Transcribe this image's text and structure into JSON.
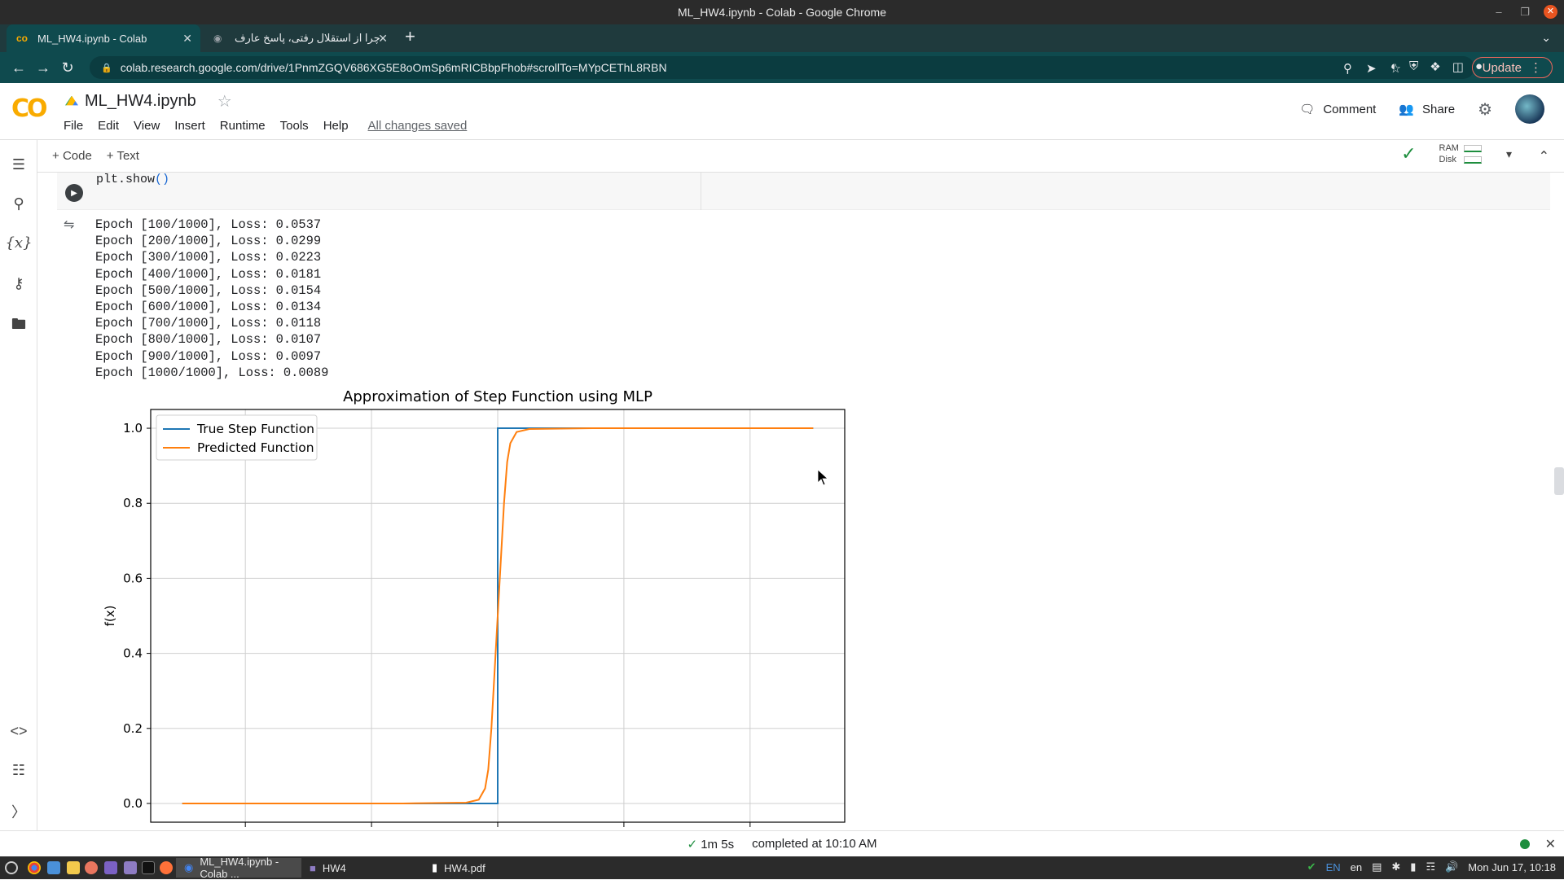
{
  "os": {
    "window_title": "ML_HW4.ipynb - Colab - Google Chrome",
    "clock": "Mon Jun 17, 10:18",
    "lang1": "EN",
    "lang2": "en"
  },
  "browser": {
    "tabs": [
      {
        "title": "ML_HW4.ipynb - Colab",
        "active": true
      },
      {
        "title": "چرا از استقلال رفتی، پاسخ عارف",
        "active": false
      }
    ],
    "url": "colab.research.google.com/drive/1PnmZGQV686XG5E8oOmSp6mRICBbpFhob#scrollTo=MYpCEThL8RBN",
    "update_label": "Update"
  },
  "colab": {
    "notebook_title": "ML_HW4.ipynb",
    "menu": [
      "File",
      "Edit",
      "View",
      "Insert",
      "Runtime",
      "Tools",
      "Help"
    ],
    "save_status": "All changes saved",
    "comment_label": "Comment",
    "share_label": "Share",
    "add_code_label": "Code",
    "add_text_label": "Text",
    "ram_label": "RAM",
    "disk_label": "Disk"
  },
  "cell": {
    "code_tail": "plt.show",
    "code_parens": "()"
  },
  "output_lines": [
    "Epoch [100/1000], Loss: 0.0537",
    "Epoch [200/1000], Loss: 0.0299",
    "Epoch [300/1000], Loss: 0.0223",
    "Epoch [400/1000], Loss: 0.0181",
    "Epoch [500/1000], Loss: 0.0154",
    "Epoch [600/1000], Loss: 0.0134",
    "Epoch [700/1000], Loss: 0.0118",
    "Epoch [800/1000], Loss: 0.0107",
    "Epoch [900/1000], Loss: 0.0097",
    "Epoch [1000/1000], Loss: 0.0089"
  ],
  "chart_data": {
    "type": "line",
    "title": "Approximation of Step Function using MLP",
    "xlabel": "",
    "ylabel": "f(x)",
    "xlim": [
      -1.1,
      1.1
    ],
    "ylim": [
      -0.05,
      1.05
    ],
    "yticks": [
      "0.0",
      "0.2",
      "0.4",
      "0.6",
      "0.8",
      "1.0"
    ],
    "ytick_values": [
      0,
      0.2,
      0.4,
      0.6,
      0.8,
      1.0
    ],
    "xticks_unlabeled": [
      -0.8,
      -0.4,
      0.0,
      0.4,
      0.8
    ],
    "grid": true,
    "legend_position": "upper-left",
    "series": [
      {
        "name": "True Step Function",
        "color": "#1f77b4",
        "x": [
          -1.0,
          0.0,
          0.0,
          1.0
        ],
        "y": [
          0.0,
          0.0,
          1.0,
          1.0
        ]
      },
      {
        "name": "Predicted Function",
        "color": "#ff7f0e",
        "x": [
          -1.0,
          -0.3,
          -0.1,
          -0.06,
          -0.04,
          -0.03,
          -0.02,
          -0.01,
          0.0,
          0.01,
          0.02,
          0.03,
          0.04,
          0.06,
          0.1,
          0.3,
          1.0
        ],
        "y": [
          0.0,
          0.0,
          0.002,
          0.01,
          0.04,
          0.09,
          0.2,
          0.35,
          0.5,
          0.65,
          0.8,
          0.91,
          0.96,
          0.99,
          0.998,
          1.0,
          1.0
        ]
      }
    ]
  },
  "statusbar": {
    "duration": "1m 5s",
    "completed": "completed at 10:10 AM"
  },
  "taskbar": {
    "tasks": [
      "ML_HW4.ipynb - Colab ...",
      "HW4",
      "HW4.pdf"
    ]
  }
}
